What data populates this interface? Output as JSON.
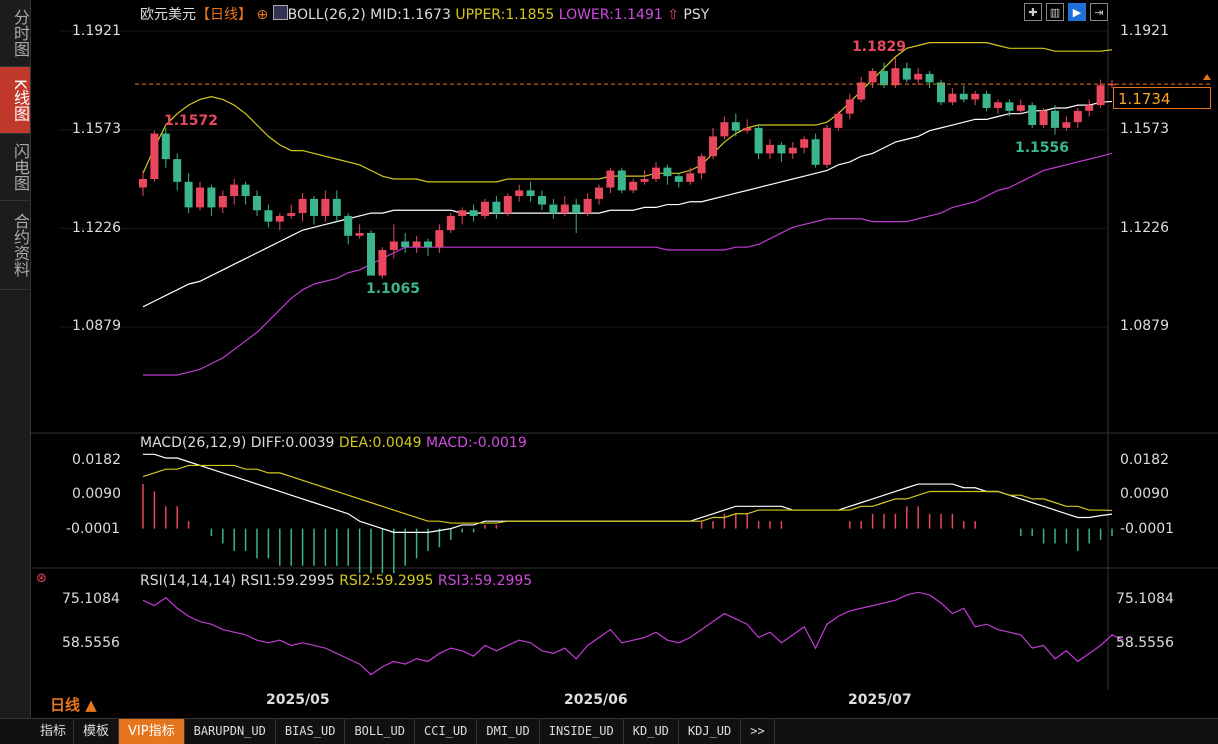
{
  "sidebar": [
    {
      "label": "分时图"
    },
    {
      "label": "K线图"
    },
    {
      "label": "闪电图"
    },
    {
      "label": "合约资料"
    }
  ],
  "header": {
    "symbol": "欧元美元",
    "period": "【日线】",
    "boll": "BOLL(26,2)",
    "mid": "MID:1.1673",
    "upper": "UPPER:1.1855",
    "lower": "LOWER:1.1491",
    "psy": "PSY"
  },
  "price_axis": {
    "left": [
      "1.1921",
      "1.1573",
      "1.1226",
      "1.0879"
    ],
    "right": [
      "1.1921",
      "1.1573",
      "1.1226",
      "1.0879"
    ],
    "current": "1.1734"
  },
  "annotations": {
    "high1": "1.1572",
    "low1": "1.1065",
    "high2": "1.1829",
    "low2": "1.1556"
  },
  "macd": {
    "title": "MACD(26,12,9)",
    "diff": "DIFF:0.0039",
    "dea": "DEA:0.0049",
    "macd": "MACD:-0.0019",
    "axis": [
      "0.0182",
      "0.0090",
      "-0.0001"
    ]
  },
  "rsi": {
    "title": "RSI(14,14,14)",
    "rsi1": "RSI1:59.2995",
    "rsi2": "RSI2:59.2995",
    "rsi3": "RSI3:59.2995",
    "axis": [
      "75.1084",
      "58.5556"
    ]
  },
  "dates": [
    "2025/05",
    "2025/06",
    "2025/07"
  ],
  "period_selector": "日线 ▲",
  "bottom_tabs": [
    "指标",
    "模板",
    "VIP指标",
    "BARUPDN_UD",
    "BIAS_UD",
    "BOLL_UD",
    "CCI_UD",
    "DMI_UD",
    "INSIDE_UD",
    "KD_UD",
    "KDJ_UD",
    ">>"
  ],
  "colors": {
    "up": "#e8475e",
    "down": "#3bb58c",
    "upper": "#d4c81e",
    "mid": "#ffffff",
    "lower": "#c13bd4",
    "accent": "#e6761d"
  },
  "chart_data": {
    "type": "candlestick",
    "ylim": [
      1.07,
      1.195
    ],
    "last_price": 1.1734,
    "candles": [
      [
        1.137,
        1.14,
        1.143,
        1.134
      ],
      [
        1.14,
        1.156,
        1.157,
        1.139
      ],
      [
        1.156,
        1.147,
        1.158,
        1.144
      ],
      [
        1.147,
        1.139,
        1.149,
        1.136
      ],
      [
        1.139,
        1.13,
        1.142,
        1.128
      ],
      [
        1.13,
        1.137,
        1.139,
        1.129
      ],
      [
        1.137,
        1.13,
        1.138,
        1.127
      ],
      [
        1.13,
        1.134,
        1.136,
        1.128
      ],
      [
        1.134,
        1.138,
        1.14,
        1.131
      ],
      [
        1.138,
        1.134,
        1.139,
        1.131
      ],
      [
        1.134,
        1.129,
        1.136,
        1.127
      ],
      [
        1.129,
        1.125,
        1.131,
        1.123
      ],
      [
        1.125,
        1.127,
        1.128,
        1.122
      ],
      [
        1.127,
        1.128,
        1.131,
        1.126
      ],
      [
        1.128,
        1.133,
        1.135,
        1.125
      ],
      [
        1.133,
        1.127,
        1.134,
        1.124
      ],
      [
        1.127,
        1.133,
        1.136,
        1.125
      ],
      [
        1.133,
        1.127,
        1.136,
        1.125
      ],
      [
        1.127,
        1.12,
        1.128,
        1.117
      ],
      [
        1.12,
        1.121,
        1.124,
        1.119
      ],
      [
        1.121,
        1.106,
        1.122,
        1.1065
      ],
      [
        1.106,
        1.115,
        1.116,
        1.105
      ],
      [
        1.115,
        1.118,
        1.124,
        1.112
      ],
      [
        1.118,
        1.116,
        1.121,
        1.114
      ],
      [
        1.116,
        1.118,
        1.12,
        1.114
      ],
      [
        1.118,
        1.116,
        1.119,
        1.113
      ],
      [
        1.116,
        1.122,
        1.124,
        1.114
      ],
      [
        1.122,
        1.127,
        1.128,
        1.121
      ],
      [
        1.127,
        1.129,
        1.13,
        1.124
      ],
      [
        1.129,
        1.127,
        1.131,
        1.125
      ],
      [
        1.127,
        1.132,
        1.133,
        1.126
      ],
      [
        1.132,
        1.128,
        1.134,
        1.126
      ],
      [
        1.128,
        1.134,
        1.135,
        1.127
      ],
      [
        1.134,
        1.136,
        1.138,
        1.132
      ],
      [
        1.136,
        1.134,
        1.139,
        1.132
      ],
      [
        1.134,
        1.131,
        1.136,
        1.129
      ],
      [
        1.131,
        1.128,
        1.133,
        1.126
      ],
      [
        1.128,
        1.131,
        1.134,
        1.127
      ],
      [
        1.131,
        1.128,
        1.133,
        1.121
      ],
      [
        1.128,
        1.133,
        1.135,
        1.127
      ],
      [
        1.133,
        1.137,
        1.138,
        1.131
      ],
      [
        1.137,
        1.143,
        1.144,
        1.135
      ],
      [
        1.143,
        1.136,
        1.144,
        1.135
      ],
      [
        1.136,
        1.139,
        1.14,
        1.135
      ],
      [
        1.139,
        1.14,
        1.143,
        1.138
      ],
      [
        1.14,
        1.144,
        1.146,
        1.139
      ],
      [
        1.144,
        1.141,
        1.145,
        1.138
      ],
      [
        1.141,
        1.139,
        1.142,
        1.137
      ],
      [
        1.139,
        1.142,
        1.144,
        1.138
      ],
      [
        1.142,
        1.148,
        1.149,
        1.14
      ],
      [
        1.148,
        1.155,
        1.158,
        1.147
      ],
      [
        1.155,
        1.16,
        1.162,
        1.154
      ],
      [
        1.16,
        1.157,
        1.163,
        1.155
      ],
      [
        1.157,
        1.158,
        1.161,
        1.156
      ],
      [
        1.158,
        1.149,
        1.159,
        1.147
      ],
      [
        1.149,
        1.152,
        1.154,
        1.147
      ],
      [
        1.152,
        1.149,
        1.153,
        1.146
      ],
      [
        1.149,
        1.151,
        1.153,
        1.147
      ],
      [
        1.151,
        1.154,
        1.155,
        1.149
      ],
      [
        1.154,
        1.145,
        1.156,
        1.144
      ],
      [
        1.145,
        1.158,
        1.159,
        1.144
      ],
      [
        1.158,
        1.163,
        1.164,
        1.157
      ],
      [
        1.163,
        1.168,
        1.17,
        1.161
      ],
      [
        1.168,
        1.174,
        1.176,
        1.167
      ],
      [
        1.174,
        1.178,
        1.179,
        1.172
      ],
      [
        1.178,
        1.173,
        1.181,
        1.172
      ],
      [
        1.173,
        1.179,
        1.1829,
        1.172
      ],
      [
        1.179,
        1.175,
        1.181,
        1.174
      ],
      [
        1.175,
        1.177,
        1.179,
        1.173
      ],
      [
        1.177,
        1.174,
        1.178,
        1.172
      ],
      [
        1.174,
        1.167,
        1.175,
        1.166
      ],
      [
        1.167,
        1.17,
        1.172,
        1.166
      ],
      [
        1.17,
        1.168,
        1.173,
        1.167
      ],
      [
        1.168,
        1.17,
        1.171,
        1.166
      ],
      [
        1.17,
        1.165,
        1.171,
        1.164
      ],
      [
        1.165,
        1.167,
        1.168,
        1.163
      ],
      [
        1.167,
        1.164,
        1.168,
        1.162
      ],
      [
        1.164,
        1.166,
        1.168,
        1.163
      ],
      [
        1.166,
        1.159,
        1.167,
        1.158
      ],
      [
        1.159,
        1.164,
        1.165,
        1.158
      ],
      [
        1.164,
        1.158,
        1.166,
        1.1556
      ],
      [
        1.158,
        1.16,
        1.162,
        1.157
      ],
      [
        1.16,
        1.164,
        1.165,
        1.158
      ],
      [
        1.164,
        1.166,
        1.168,
        1.162
      ],
      [
        1.166,
        1.173,
        1.175,
        1.165
      ],
      [
        1.173,
        1.1734,
        1.175,
        1.172
      ]
    ],
    "upper": [
      1.142,
      1.151,
      1.159,
      1.163,
      1.166,
      1.168,
      1.169,
      1.168,
      1.166,
      1.163,
      1.159,
      1.155,
      1.152,
      1.15,
      1.15,
      1.149,
      1.148,
      1.147,
      1.146,
      1.145,
      1.143,
      1.141,
      1.14,
      1.14,
      1.14,
      1.139,
      1.139,
      1.139,
      1.139,
      1.139,
      1.139,
      1.139,
      1.14,
      1.14,
      1.14,
      1.14,
      1.14,
      1.14,
      1.14,
      1.14,
      1.14,
      1.141,
      1.141,
      1.141,
      1.141,
      1.142,
      1.142,
      1.142,
      1.143,
      1.145,
      1.149,
      1.153,
      1.156,
      1.158,
      1.159,
      1.159,
      1.159,
      1.159,
      1.159,
      1.159,
      1.16,
      1.163,
      1.167,
      1.171,
      1.175,
      1.179,
      1.183,
      1.186,
      1.187,
      1.188,
      1.188,
      1.188,
      1.188,
      1.188,
      1.188,
      1.187,
      1.186,
      1.186,
      1.186,
      1.186,
      1.185,
      1.185,
      1.185,
      1.185,
      1.185,
      1.1855
    ],
    "mid": [
      1.095,
      1.097,
      1.099,
      1.101,
      1.103,
      1.104,
      1.106,
      1.108,
      1.11,
      1.112,
      1.114,
      1.116,
      1.118,
      1.12,
      1.122,
      1.123,
      1.124,
      1.125,
      1.126,
      1.127,
      1.128,
      1.128,
      1.129,
      1.129,
      1.129,
      1.129,
      1.129,
      1.129,
      1.128,
      1.128,
      1.128,
      1.128,
      1.128,
      1.128,
      1.128,
      1.128,
      1.128,
      1.128,
      1.128,
      1.128,
      1.128,
      1.129,
      1.129,
      1.129,
      1.13,
      1.13,
      1.131,
      1.131,
      1.132,
      1.132,
      1.133,
      1.134,
      1.135,
      1.136,
      1.137,
      1.138,
      1.139,
      1.14,
      1.141,
      1.142,
      1.143,
      1.145,
      1.146,
      1.148,
      1.149,
      1.151,
      1.153,
      1.154,
      1.155,
      1.157,
      1.158,
      1.159,
      1.16,
      1.161,
      1.161,
      1.162,
      1.163,
      1.163,
      1.164,
      1.164,
      1.165,
      1.165,
      1.166,
      1.166,
      1.167,
      1.1673
    ],
    "lower": [
      1.071,
      1.071,
      1.071,
      1.071,
      1.072,
      1.073,
      1.075,
      1.077,
      1.08,
      1.083,
      1.086,
      1.09,
      1.094,
      1.098,
      1.101,
      1.103,
      1.104,
      1.105,
      1.107,
      1.108,
      1.11,
      1.112,
      1.114,
      1.116,
      1.116,
      1.116,
      1.116,
      1.116,
      1.116,
      1.116,
      1.116,
      1.116,
      1.116,
      1.116,
      1.116,
      1.116,
      1.116,
      1.116,
      1.116,
      1.116,
      1.116,
      1.116,
      1.116,
      1.116,
      1.116,
      1.116,
      1.115,
      1.115,
      1.115,
      1.115,
      1.115,
      1.115,
      1.116,
      1.116,
      1.117,
      1.119,
      1.121,
      1.123,
      1.124,
      1.125,
      1.126,
      1.126,
      1.126,
      1.126,
      1.125,
      1.125,
      1.125,
      1.125,
      1.126,
      1.127,
      1.128,
      1.13,
      1.131,
      1.132,
      1.134,
      1.136,
      1.137,
      1.139,
      1.141,
      1.143,
      1.144,
      1.145,
      1.146,
      1.147,
      1.148,
      1.1491
    ],
    "macd_ylim": [
      -0.008,
      0.022
    ],
    "diff": [
      0.02,
      0.02,
      0.019,
      0.019,
      0.018,
      0.017,
      0.016,
      0.015,
      0.014,
      0.013,
      0.012,
      0.011,
      0.01,
      0.009,
      0.008,
      0.007,
      0.006,
      0.005,
      0.004,
      0.002,
      0.001,
      0.0,
      -0.001,
      -0.001,
      -0.001,
      -0.001,
      -0.0005,
      0.0,
      0.001,
      0.001,
      0.002,
      0.002,
      0.002,
      0.002,
      0.002,
      0.002,
      0.002,
      0.002,
      0.002,
      0.002,
      0.002,
      0.002,
      0.002,
      0.002,
      0.002,
      0.002,
      0.002,
      0.002,
      0.002,
      0.003,
      0.004,
      0.005,
      0.006,
      0.006,
      0.006,
      0.006,
      0.006,
      0.005,
      0.005,
      0.005,
      0.005,
      0.005,
      0.006,
      0.007,
      0.008,
      0.009,
      0.01,
      0.011,
      0.012,
      0.012,
      0.012,
      0.012,
      0.011,
      0.011,
      0.01,
      0.01,
      0.009,
      0.008,
      0.007,
      0.006,
      0.005,
      0.004,
      0.003,
      0.003,
      0.0035,
      0.0039
    ],
    "dea": [
      0.014,
      0.015,
      0.016,
      0.016,
      0.017,
      0.017,
      0.017,
      0.017,
      0.017,
      0.016,
      0.016,
      0.015,
      0.015,
      0.014,
      0.013,
      0.012,
      0.011,
      0.01,
      0.009,
      0.008,
      0.007,
      0.006,
      0.005,
      0.004,
      0.003,
      0.002,
      0.002,
      0.0015,
      0.0015,
      0.0015,
      0.0015,
      0.0015,
      0.002,
      0.002,
      0.002,
      0.002,
      0.002,
      0.002,
      0.002,
      0.002,
      0.002,
      0.002,
      0.002,
      0.002,
      0.002,
      0.002,
      0.002,
      0.002,
      0.002,
      0.002,
      0.003,
      0.003,
      0.004,
      0.004,
      0.005,
      0.005,
      0.005,
      0.005,
      0.005,
      0.005,
      0.005,
      0.005,
      0.005,
      0.006,
      0.006,
      0.007,
      0.008,
      0.008,
      0.009,
      0.01,
      0.01,
      0.01,
      0.01,
      0.01,
      0.01,
      0.01,
      0.009,
      0.009,
      0.008,
      0.008,
      0.007,
      0.006,
      0.006,
      0.005,
      0.005,
      0.0049
    ],
    "rsi_ylim": [
      44,
      82
    ],
    "rsi_values": [
      75,
      73,
      76,
      72,
      69,
      67,
      66,
      64,
      63,
      62,
      60,
      59,
      60,
      58,
      59,
      58,
      57,
      55,
      53,
      51,
      47,
      50,
      52,
      51,
      53,
      52,
      55,
      57,
      56,
      54,
      58,
      56,
      58,
      60,
      59,
      56,
      55,
      57,
      53,
      58,
      61,
      64,
      59,
      60,
      61,
      63,
      60,
      59,
      61,
      64,
      67,
      70,
      68,
      66,
      61,
      63,
      59,
      62,
      65,
      57,
      66,
      69,
      71,
      72,
      73,
      74,
      75,
      77,
      78,
      77,
      74,
      70,
      72,
      65,
      66,
      64,
      63,
      62,
      57,
      58,
      53,
      56,
      52,
      55,
      58,
      62,
      60
    ]
  }
}
